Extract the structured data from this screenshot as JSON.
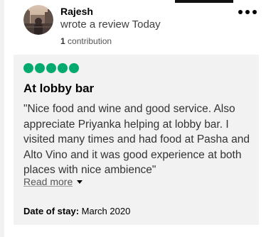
{
  "review": {
    "user_name": "Rajesh",
    "action_text": "wrote a review Today",
    "contribution_count": "1",
    "contribution_label": "contribution",
    "avatar_icon": "user-avatar-photo",
    "more_icon": "more-options-icon",
    "rating": 5,
    "rating_max": 5,
    "rating_color": "#00aa6c",
    "title": "At lobby bar",
    "body": "\"Nice food and wine and good service. Also appreciate Priyanka helping at lobby bar. I visited many times and had food at Pasha and Alto Vino and it was good experience at both places with nice ambience\"",
    "read_more_label": "Read more",
    "date_of_stay_label": "Date of stay:",
    "date_of_stay_value": "March 2020"
  }
}
